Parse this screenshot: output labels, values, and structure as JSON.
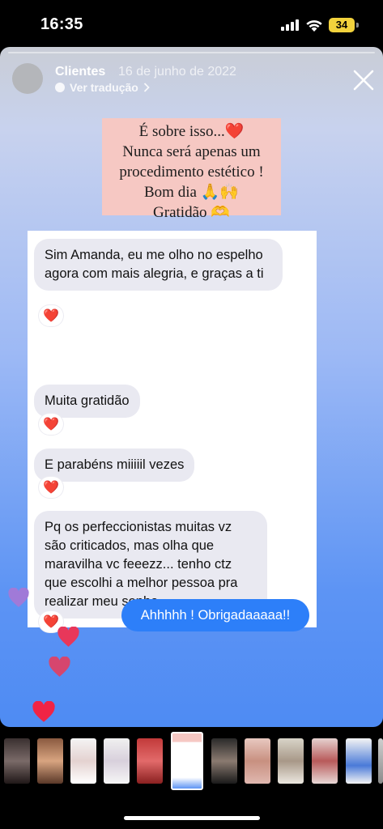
{
  "status": {
    "time": "16:35",
    "battery": "34"
  },
  "story": {
    "username": "Clientes",
    "date": "16 de junho de 2022",
    "translate_label": "Ver tradução",
    "quote_lines": [
      "É sobre isso...❤️",
      "Nunca será apenas um",
      "procedimento estético !",
      "Bom dia 🙏🙌",
      "Gratidão 🫶"
    ]
  },
  "chat": {
    "received": [
      "Sim Amanda,  eu me olho no espelho agora com mais alegria,  e graças a ti",
      "Muita gratidão",
      "E parabéns miiiiil vezes",
      "Pq os perfeccionistas muitas vz são criticados, mas olha que maravilha vc feeezz... tenho ctz que escolhi a melhor pessoa pra realizar meu sonho"
    ],
    "reaction": "❤️",
    "sent": "Ahhhhh ! Obrigadaaaaa!!"
  },
  "icons": {
    "close": "close-icon",
    "chevron": "chevron-right-icon",
    "heart": "heart-icon"
  },
  "colors": {
    "sent_bubble": "#2d7ff9",
    "received_bubble": "#e9e9f1",
    "quote_bg": "#f6c8c3",
    "heart": "#e8375a"
  }
}
